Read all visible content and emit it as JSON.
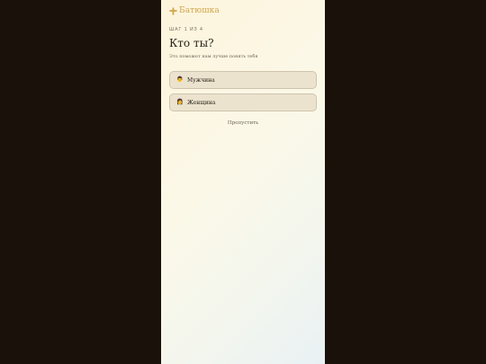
{
  "app": {
    "brand_name": "Батюшка",
    "brand_color": "#d0a64a",
    "brand_icon": "cross-icon"
  },
  "onboarding": {
    "step_label": "ШАГ 1 ИЗ 4",
    "title": "Кто ты?",
    "subtitle": "Это поможет нам лучше понять тебя",
    "options": [
      {
        "emoji": "👨",
        "label": "Мужчина",
        "icon": "man-emoji-icon"
      },
      {
        "emoji": "👩",
        "label": "Женщина",
        "icon": "woman-emoji-icon"
      }
    ],
    "skip_label": "Пропустить"
  }
}
